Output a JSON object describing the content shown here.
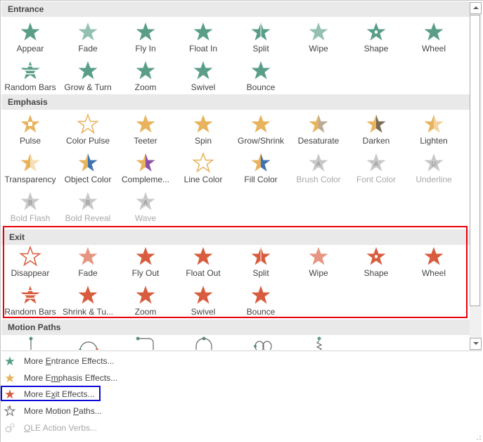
{
  "colors": {
    "entrance": "#5a9e89",
    "emphasis": "#e8b35c",
    "exit": "#d85c3e",
    "disabled": "#c8c8c8",
    "exit_highlight": "#e8000b",
    "menu_highlight": "#0a0ad8"
  },
  "sections": {
    "entrance": {
      "title": "Entrance",
      "items": [
        {
          "label": "Appear",
          "icon": "star-appear-icon"
        },
        {
          "label": "Fade",
          "icon": "star-fade-icon"
        },
        {
          "label": "Fly In",
          "icon": "star-fly-in-icon"
        },
        {
          "label": "Float In",
          "icon": "star-float-in-icon"
        },
        {
          "label": "Split",
          "icon": "star-split-icon"
        },
        {
          "label": "Wipe",
          "icon": "star-wipe-icon"
        },
        {
          "label": "Shape",
          "icon": "star-shape-icon"
        },
        {
          "label": "Wheel",
          "icon": "star-wheel-icon"
        },
        {
          "label": "Random Bars",
          "icon": "star-random-bars-icon"
        },
        {
          "label": "Grow & Turn",
          "icon": "star-grow-turn-icon"
        },
        {
          "label": "Zoom",
          "icon": "star-zoom-icon"
        },
        {
          "label": "Swivel",
          "icon": "star-swivel-icon"
        },
        {
          "label": "Bounce",
          "icon": "star-bounce-icon"
        }
      ]
    },
    "emphasis": {
      "title": "Emphasis",
      "items": [
        {
          "label": "Pulse",
          "icon": "star-pulse-icon"
        },
        {
          "label": "Color Pulse",
          "icon": "star-color-pulse-icon"
        },
        {
          "label": "Teeter",
          "icon": "star-teeter-icon"
        },
        {
          "label": "Spin",
          "icon": "star-spin-icon"
        },
        {
          "label": "Grow/Shrink",
          "icon": "star-grow-shrink-icon"
        },
        {
          "label": "Desaturate",
          "icon": "star-desaturate-icon"
        },
        {
          "label": "Darken",
          "icon": "star-darken-icon"
        },
        {
          "label": "Lighten",
          "icon": "star-lighten-icon"
        },
        {
          "label": "Transparency",
          "icon": "star-transparency-icon"
        },
        {
          "label": "Object Color",
          "icon": "star-object-color-icon"
        },
        {
          "label": "Compleme...",
          "icon": "star-complementary-icon"
        },
        {
          "label": "Line Color",
          "icon": "star-line-color-icon"
        },
        {
          "label": "Fill Color",
          "icon": "star-fill-color-icon"
        },
        {
          "label": "Brush Color",
          "icon": "star-brush-color-icon",
          "disabled": true
        },
        {
          "label": "Font Color",
          "icon": "star-font-color-icon",
          "disabled": true
        },
        {
          "label": "Underline",
          "icon": "star-underline-icon",
          "disabled": true
        },
        {
          "label": "Bold Flash",
          "icon": "star-bold-flash-icon",
          "disabled": true
        },
        {
          "label": "Bold Reveal",
          "icon": "star-bold-reveal-icon",
          "disabled": true
        },
        {
          "label": "Wave",
          "icon": "star-wave-icon",
          "disabled": true
        }
      ]
    },
    "exit": {
      "title": "Exit",
      "items": [
        {
          "label": "Disappear",
          "icon": "star-disappear-icon"
        },
        {
          "label": "Fade",
          "icon": "star-fade-icon"
        },
        {
          "label": "Fly Out",
          "icon": "star-fly-out-icon"
        },
        {
          "label": "Float Out",
          "icon": "star-float-out-icon"
        },
        {
          "label": "Split",
          "icon": "star-split-icon"
        },
        {
          "label": "Wipe",
          "icon": "star-wipe-icon"
        },
        {
          "label": "Shape",
          "icon": "star-shape-icon"
        },
        {
          "label": "Wheel",
          "icon": "star-wheel-icon"
        },
        {
          "label": "Random Bars",
          "icon": "star-random-bars-icon"
        },
        {
          "label": "Shrink & Tu...",
          "icon": "star-shrink-turn-icon"
        },
        {
          "label": "Zoom",
          "icon": "star-zoom-icon"
        },
        {
          "label": "Swivel",
          "icon": "star-swivel-icon"
        },
        {
          "label": "Bounce",
          "icon": "star-bounce-icon"
        }
      ]
    },
    "motion": {
      "title": "Motion Paths",
      "items": [
        {
          "icon": "motion-path-lines-icon"
        },
        {
          "icon": "motion-path-arcs-icon"
        },
        {
          "icon": "motion-path-turns-icon"
        },
        {
          "icon": "motion-path-shapes-icon"
        },
        {
          "icon": "motion-path-loops-icon"
        },
        {
          "icon": "motion-path-custom-icon"
        }
      ]
    }
  },
  "menu": [
    {
      "pre": "More ",
      "key": "E",
      "post": "ntrance Effects...",
      "icon": "entrance-star-icon",
      "color": "#5a9e89"
    },
    {
      "pre": "More E",
      "key": "m",
      "post": "phasis Effects...",
      "icon": "emphasis-star-icon",
      "color": "#e8b35c"
    },
    {
      "pre": "More E",
      "key": "x",
      "post": "it Effects...",
      "icon": "exit-star-icon",
      "color": "#d85c3e"
    },
    {
      "pre": "More Motion ",
      "key": "P",
      "post": "aths...",
      "icon": "motion-path-star-icon",
      "color": "#666666"
    },
    {
      "pre": "",
      "key": "O",
      "post": "LE Action Verbs...",
      "icon": "ole-gears-icon",
      "color": "#a8a8a8",
      "disabled": true
    }
  ]
}
